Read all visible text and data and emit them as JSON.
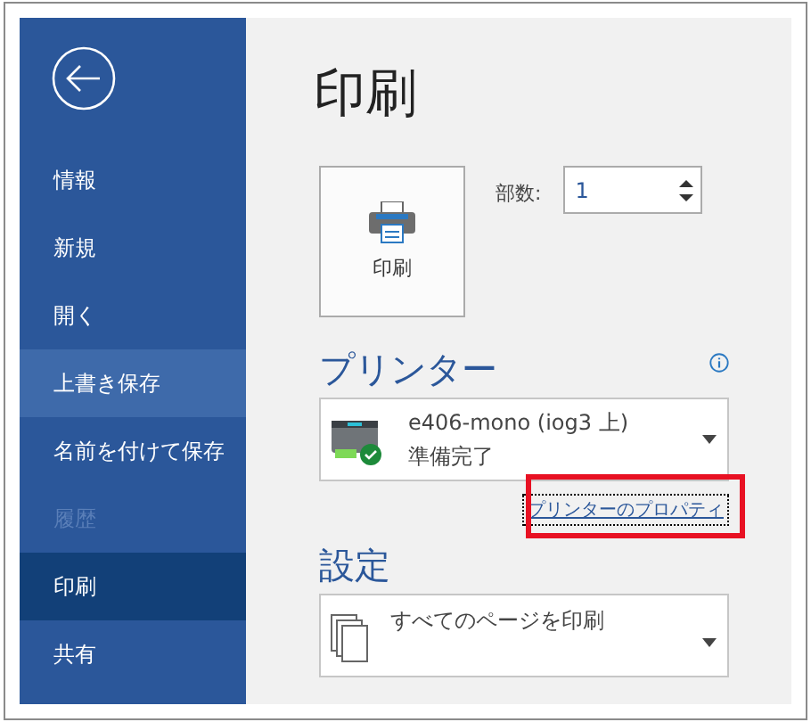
{
  "sidebar": {
    "items": [
      {
        "label": "情報",
        "selected": false,
        "highlighted": false,
        "disabled": false
      },
      {
        "label": "新規",
        "selected": false,
        "highlighted": false,
        "disabled": false
      },
      {
        "label": "開く",
        "selected": false,
        "highlighted": false,
        "disabled": false
      },
      {
        "label": "上書き保存",
        "selected": false,
        "highlighted": true,
        "disabled": false
      },
      {
        "label": "名前を付けて保存",
        "selected": false,
        "highlighted": false,
        "disabled": false
      },
      {
        "label": "履歴",
        "selected": false,
        "highlighted": false,
        "disabled": true
      },
      {
        "label": "印刷",
        "selected": true,
        "highlighted": false,
        "disabled": false
      },
      {
        "label": "共有",
        "selected": false,
        "highlighted": false,
        "disabled": false
      }
    ]
  },
  "title": "印刷",
  "print_button": {
    "label": "印刷"
  },
  "copies": {
    "label": "部数:",
    "value": "1"
  },
  "printer": {
    "heading": "プリンター",
    "name": "e406-mono (iog3 上)",
    "status": "準備完了",
    "properties_link": "プリンターのプロパティ",
    "link_highlighted": true
  },
  "settings": {
    "heading": "設定",
    "pages": "すべてのページを印刷"
  }
}
